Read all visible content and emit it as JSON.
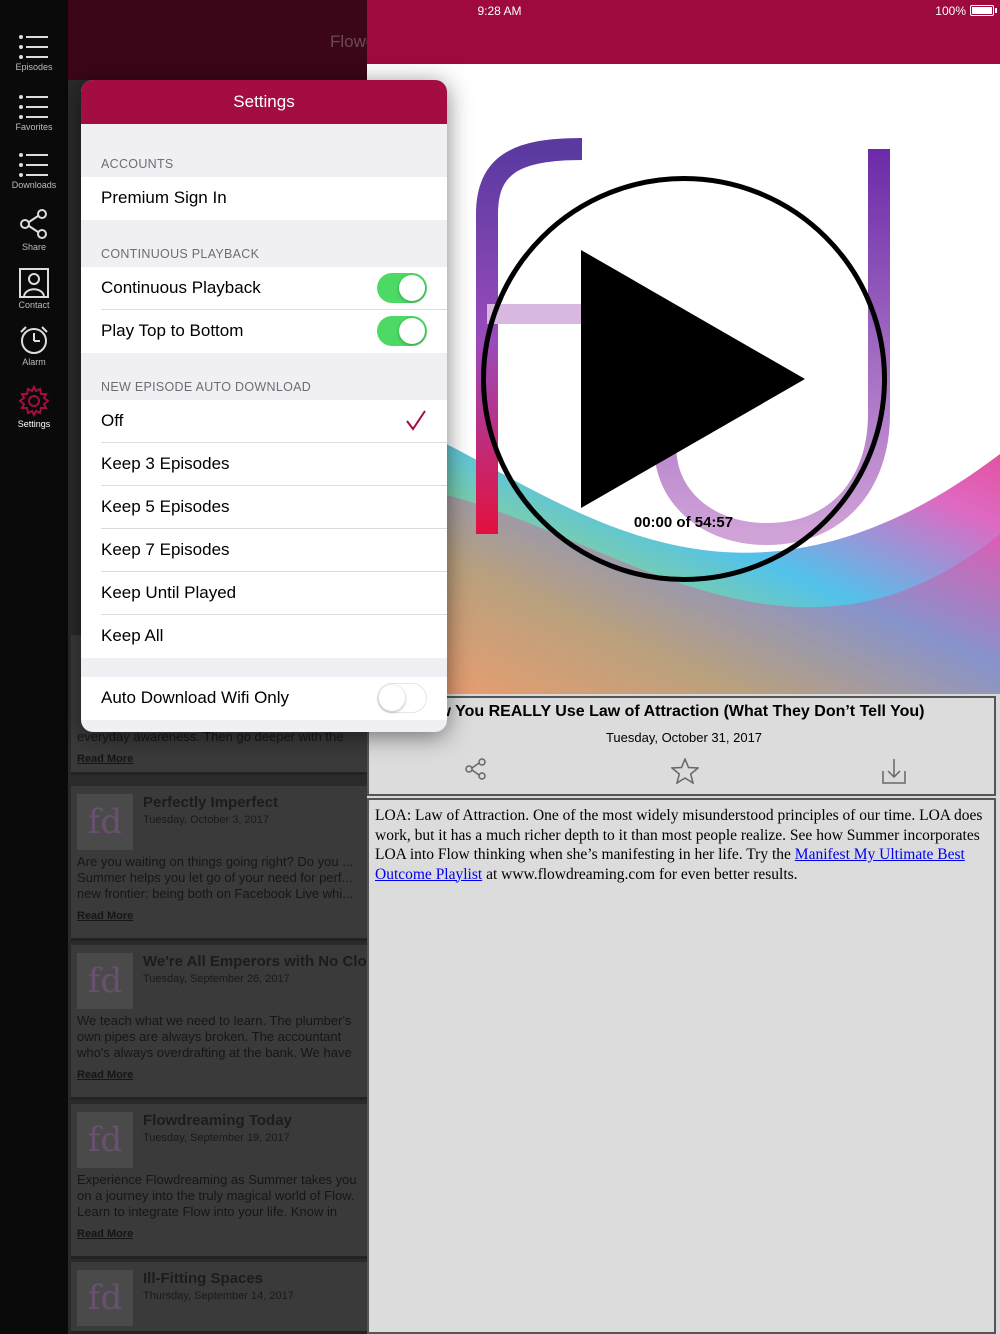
{
  "status_bar": {
    "time": "9:28 AM",
    "battery": "100%"
  },
  "app": {
    "title": "Flowdreaming"
  },
  "rail": [
    {
      "label": "Episodes",
      "icon": "list-icon"
    },
    {
      "label": "Favorites",
      "icon": "list-icon"
    },
    {
      "label": "Downloads",
      "icon": "list-icon"
    },
    {
      "label": "Share",
      "icon": "share-icon"
    },
    {
      "label": "Contact",
      "icon": "contact-icon"
    },
    {
      "label": "Alarm",
      "icon": "alarm-icon"
    },
    {
      "label": "Settings",
      "icon": "gear-icon"
    }
  ],
  "episodes": [
    {
      "title": "Perfectly Imperfect",
      "date": "Tuesday, October 3, 2017",
      "desc": "Are you waiting on things going right? Do you ... Summer helps you let go of your need for perf... new frontier: being both on Facebook Live whi...",
      "read_more": "Read More"
    },
    {
      "title": "We're All Emperors with No Clothes",
      "date": "Tuesday, September 26, 2017",
      "desc": "We teach what we need to learn. The plumber's own pipes are always broken. The accountant who's always overdrafting at the bank. We have dozens of ways of saying the same thing...that what we study, preach, or do for a living is often the thing that's broke...",
      "read_more": "Read More"
    },
    {
      "title": "Flowdreaming Today",
      "date": "Tuesday, September 19, 2017",
      "desc": "Experience Flowdreaming as Summer takes you on a journey into the truly magical world of Flow. Learn to integrate Flow into your life. Know in advance what your results will be. Summer brings you up to date on the latest uses for Flowdreaming, and teaches you ho...",
      "read_more": "Read More"
    },
    {
      "title": "Ill-Fitting Spaces",
      "date": "Thursday, September 14, 2017",
      "desc": "",
      "read_more": ""
    }
  ],
  "background_snippet": {
    "text": "everyday awareness. Then go deeper with the",
    "read_more": "Read More"
  },
  "player": {
    "time": "00:00 of 54:57",
    "episode_title": "w You REALLY Use Law of Attraction (What They Don’t Tell You)",
    "episode_date": "Tuesday, October 31, 2017",
    "description_before": "LOA: Law of Attraction. One of the most widely misunderstood principles of our time. LOA does work, but it has a much richer depth to it than most people realize. See how Summer incorporates LOA into Flow thinking when she’s manifesting in her life. Try the ",
    "description_link": "Manifest My Ultimate Best Outcome Playlist",
    "description_after": " at www.flowdreaming.com for even better results."
  },
  "settings": {
    "title": "Settings",
    "accounts_label": "ACCOUNTS",
    "premium_sign_in": "Premium Sign In",
    "continuous_label": "CONTINUOUS PLAYBACK",
    "continuous_playback": "Continuous Playback",
    "continuous_playback_on": true,
    "play_top_to_bottom": "Play Top to Bottom",
    "play_top_to_bottom_on": true,
    "auto_download_label": "NEW EPISODE AUTO DOWNLOAD",
    "auto_download_options": [
      "Off",
      "Keep 3 Episodes",
      "Keep 5 Episodes",
      "Keep 7 Episodes",
      "Keep Until Played",
      "Keep All"
    ],
    "auto_download_selected": "Off",
    "wifi_only": "Auto Download Wifi Only",
    "wifi_only_on": false
  },
  "colors": {
    "brand": "#a30d42",
    "toggle_on": "#4cd964",
    "check": "#a30d42"
  }
}
